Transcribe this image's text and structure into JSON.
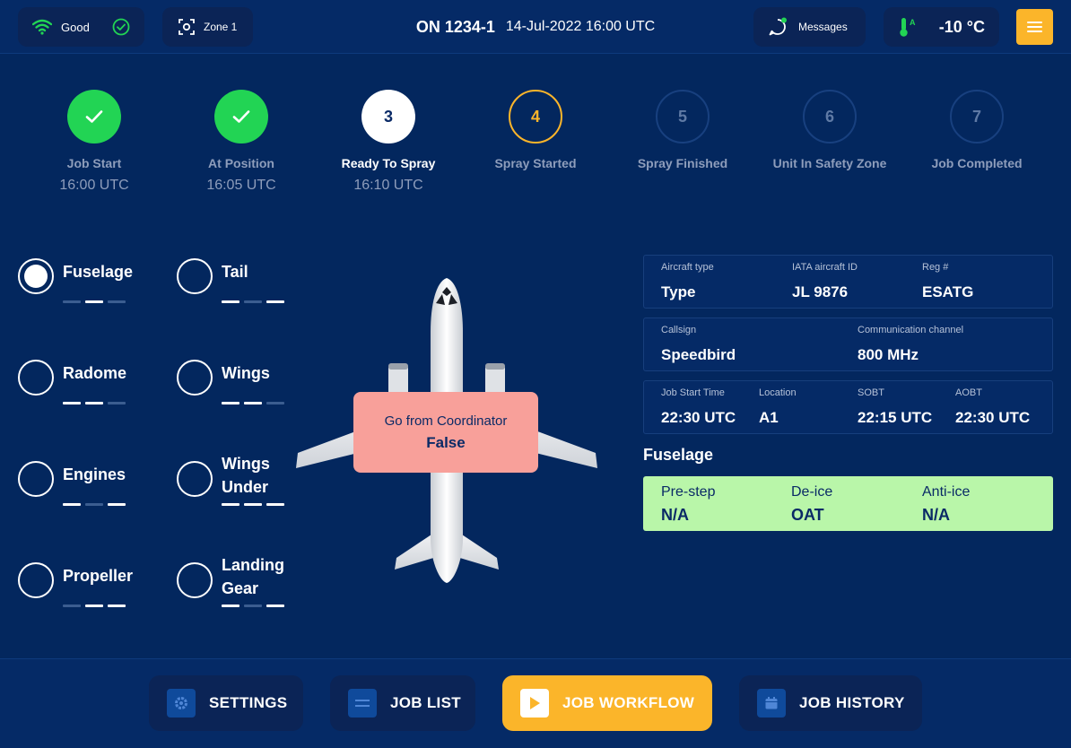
{
  "header": {
    "signal_label": "Good",
    "zone_label": "Zone 1",
    "job_id": "ON 1234-1",
    "datetime": "14-Jul-2022 16:00 UTC",
    "messages_label": "Messages",
    "temperature": "-10 °C",
    "thermo_tag": "A"
  },
  "steps": [
    {
      "marker": "",
      "name": "Job Start",
      "time": "16:00 UTC",
      "state": "done"
    },
    {
      "marker": "",
      "name": "At Position",
      "time": "16:05 UTC",
      "state": "done"
    },
    {
      "marker": "3",
      "name": "Ready To Spray",
      "time": "16:10 UTC",
      "state": "current"
    },
    {
      "marker": "4",
      "name": "Spray Started",
      "time": "",
      "state": "active"
    },
    {
      "marker": "5",
      "name": "Spray Finished",
      "time": "",
      "state": "future"
    },
    {
      "marker": "6",
      "name": "Unit In Safety Zone",
      "time": "",
      "state": "future"
    },
    {
      "marker": "7",
      "name": "Job Completed",
      "time": "",
      "state": "future"
    }
  ],
  "zones": {
    "fuselage": {
      "line1": "Fuselage",
      "line2": "",
      "selected": true,
      "bars": [
        false,
        true,
        false
      ]
    },
    "tail": {
      "line1": "Tail",
      "line2": "",
      "selected": false,
      "bars": [
        true,
        false,
        true
      ]
    },
    "radome": {
      "line1": "Radome",
      "line2": "",
      "selected": false,
      "bars": [
        true,
        true,
        false
      ]
    },
    "wings": {
      "line1": "Wings",
      "line2": "",
      "selected": false,
      "bars": [
        true,
        true,
        false
      ]
    },
    "engines": {
      "line1": "Engines",
      "line2": "",
      "selected": false,
      "bars": [
        true,
        false,
        true
      ]
    },
    "wings_under": {
      "line1": "Wings",
      "line2": "Under",
      "selected": false,
      "bars": [
        true,
        true,
        true
      ]
    },
    "propeller": {
      "line1": "Propeller",
      "line2": "",
      "selected": false,
      "bars": [
        false,
        true,
        true
      ]
    },
    "landing_gear": {
      "line1": "Landing",
      "line2": "Gear",
      "selected": false,
      "bars": [
        true,
        false,
        true
      ]
    }
  },
  "coordinator": {
    "label": "Go from Coordinator",
    "value": "False"
  },
  "aircraft": {
    "type_label": "Aircraft type",
    "type_value": "Type",
    "iata_label": "IATA aircraft ID",
    "iata_value": "JL 9876",
    "reg_label": "Reg #",
    "reg_value": "ESATG"
  },
  "comms": {
    "callsign_label": "Callsign",
    "callsign_value": "Speedbird",
    "channel_label": "Communication channel",
    "channel_value": "800 MHz"
  },
  "times": {
    "start_label": "Job Start Time",
    "start_value": "22:30 UTC",
    "location_label": "Location",
    "location_value": "A1",
    "sobt_label": "SOBT",
    "sobt_value": "22:15 UTC",
    "aobt_label": "AOBT",
    "aobt_value": "22:30 UTC"
  },
  "section": {
    "title": "Fuselage",
    "prestep_label": "Pre-step",
    "prestep_value": "N/A",
    "deice_label": "De-ice",
    "deice_value": "OAT",
    "antiice_label": "Anti-ice",
    "antiice_value": "N/A"
  },
  "nav": {
    "settings": "SETTINGS",
    "job_list": "JOB LIST",
    "job_workflow": "JOB WORKFLOW",
    "job_history": "JOB HISTORY",
    "active": "job_workflow"
  },
  "colors": {
    "background": "#03275e",
    "accent": "#fbb52a",
    "done": "#22d454",
    "coordinator_bg": "#f8a09a",
    "status_bg": "#b9f6a9"
  }
}
